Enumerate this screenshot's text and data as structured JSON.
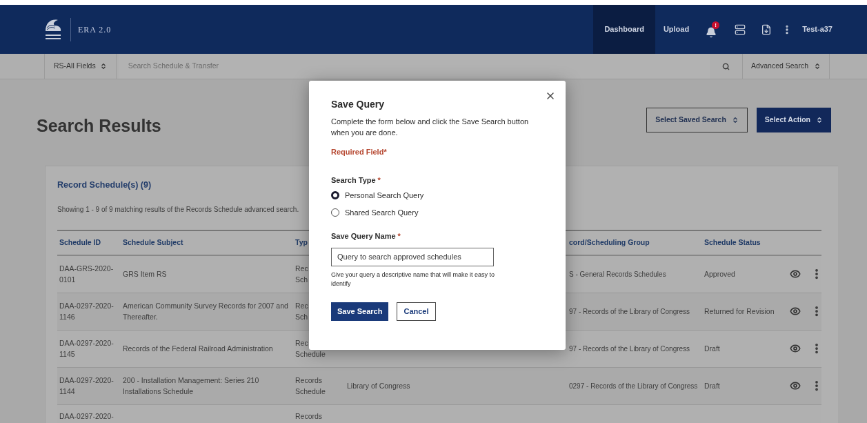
{
  "header": {
    "app_name": "ERA 2.0",
    "nav": [
      {
        "label": "Dashboard",
        "selected": true
      },
      {
        "label": "Upload",
        "selected": false
      }
    ],
    "notification_badge": "!",
    "user": "Test-a37"
  },
  "search_bar": {
    "scope": "RS-All Fields",
    "placeholder": "Search Schedule & Transfer",
    "mode": "Advanced Search"
  },
  "page": {
    "title": "Search Results",
    "buttons": [
      {
        "label": "Select Saved Search",
        "kind": "outline"
      },
      {
        "label": "Select Action",
        "kind": "primary"
      }
    ]
  },
  "results": {
    "title": "Record Schedule(s) (9)",
    "summary": "Showing 1 - 9 of 9 matching results of the Records Schedule advanced search.",
    "columns": [
      "Schedule ID",
      "Schedule Subject",
      "Typ",
      "cord/Scheduling Group",
      "Schedule Status"
    ],
    "rows": [
      {
        "id": "DAA-GRS-2020-0101",
        "subject": "GRS Item RS",
        "type": [
          "Rec",
          "Sch"
        ],
        "group": "S - General Records Schedules",
        "status": "Approved",
        "actions": true
      },
      {
        "id": "DAA-0297-2020-1146",
        "subject": "American Community Survey Records for 2007 and Thereafter.",
        "type": [
          "Rec",
          "Sch"
        ],
        "group": "97 - Records of the Library of Congress",
        "status": "Returned for Revision",
        "actions": true
      },
      {
        "id": "DAA-0297-2020-1145",
        "subject": "Records of the Federal Railroad Administration",
        "type": [
          "Rec",
          "Schedule"
        ],
        "group": "97 - Records of the Library of Congress",
        "status": "Draft",
        "actions": true
      },
      {
        "id": "DAA-0297-2020-1144",
        "subject": "200 - Installation Management: Series 210 Installations Schedule",
        "type": [
          "Records",
          "Schedule"
        ],
        "agency": "Library of Congress",
        "group": "0297 - Records of the Library of Congress",
        "status": "Draft",
        "actions": true
      },
      {
        "id": "DAA-0297-2020-",
        "type": [
          "Records"
        ],
        "actions": false
      }
    ]
  },
  "modal": {
    "title": "Save Query",
    "intro": "Complete the form below and click the Save Search button when you are done.",
    "required_note": "Required Field*",
    "search_type_label": "Search Type",
    "search_type_mark": "*",
    "options": [
      {
        "label": "Personal Search Query",
        "selected": true
      },
      {
        "label": "Shared Search Query",
        "selected": false
      }
    ],
    "name_label": "Save Query Name",
    "name_mark": "*",
    "name_value": "Query to search approved schedules",
    "hint": "Give your query a descriptive name that will make it easy to identify",
    "buttons": [
      {
        "label": "Save Search",
        "kind": "primary"
      },
      {
        "label": "Cancel",
        "kind": "secondary"
      }
    ]
  }
}
